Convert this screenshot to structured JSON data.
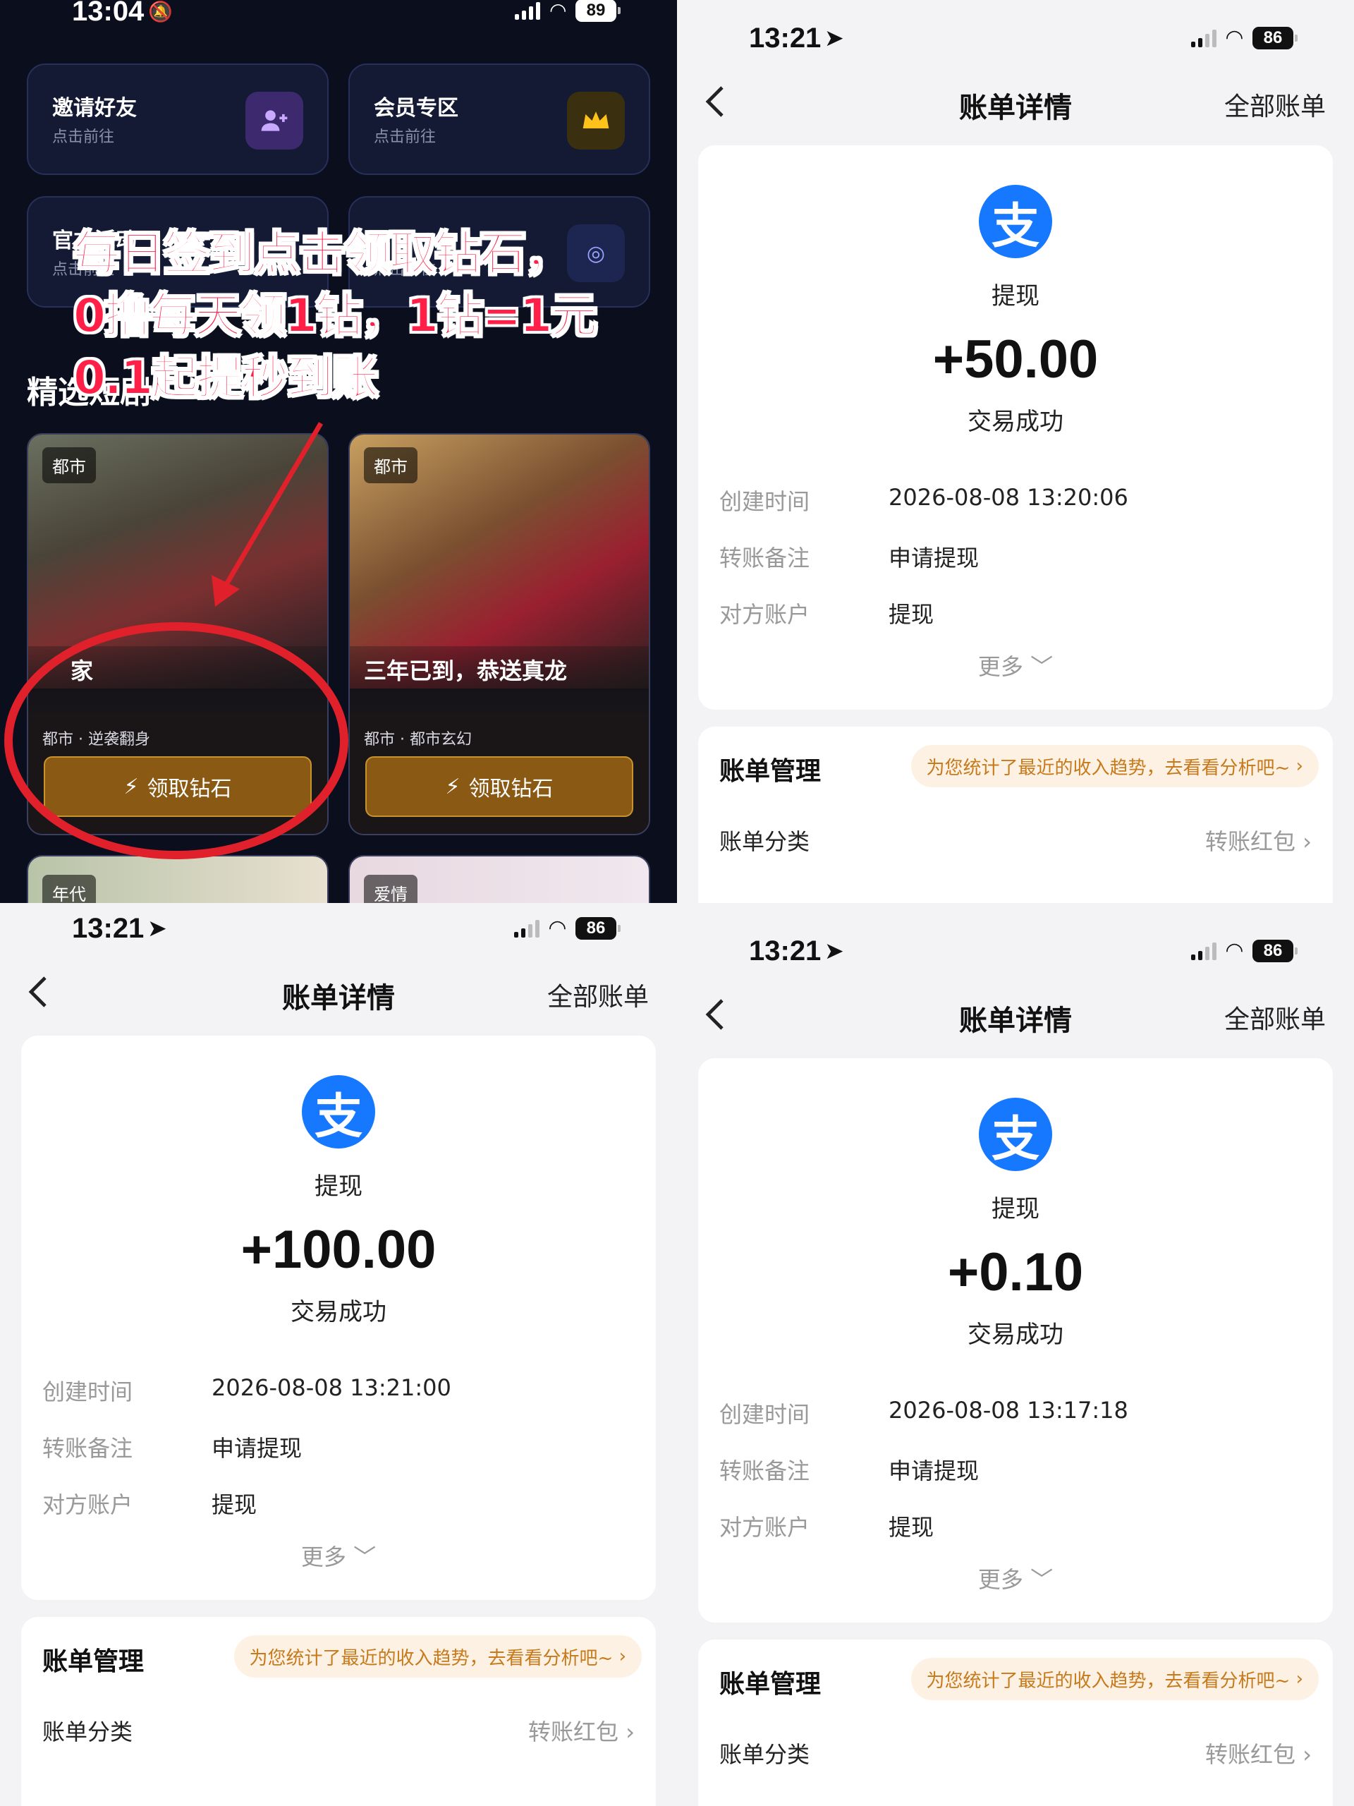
{
  "panel1": {
    "status": {
      "time": "13:04",
      "battery": "89"
    },
    "tiles": [
      {
        "title": "邀请好友",
        "subtitle": "点击前往",
        "icon": "add-user-icon"
      },
      {
        "title": "会员专区",
        "subtitle": "点击前往",
        "icon": "crown-icon"
      },
      {
        "title": "官方活动",
        "subtitle": "点击前往",
        "icon": "gift-icon"
      },
      {
        "title": "",
        "subtitle": "点击前往",
        "icon": "globe-icon"
      }
    ],
    "section_title": "精选短剧",
    "overlay_lines": [
      "每日签到点击领取钻石，",
      "0撸每天领1钻，1钻=1元",
      "0.1起提秒到账"
    ],
    "dramas": [
      {
        "tag": "都市",
        "title": "家",
        "meta": "都市 · 逆袭翻身",
        "button": "领取钻石"
      },
      {
        "tag": "都市",
        "title": "三年已到，恭送真龙",
        "meta": "都市 · 都市玄幻",
        "button": "领取钻石"
      },
      {
        "tag": "年代"
      },
      {
        "tag": "爱情"
      }
    ]
  },
  "bills": [
    {
      "time": "13:21",
      "battery": "86",
      "nav_title": "账单详情",
      "nav_all": "全部账单",
      "logo": "支",
      "type": "提现",
      "amount": "+50.00",
      "status": "交易成功",
      "rows": [
        {
          "k": "创建时间",
          "v": "2026-08-08 13:20:06"
        },
        {
          "k": "转账备注",
          "v": "申请提现"
        },
        {
          "k": "对方账户",
          "v": "提现"
        }
      ],
      "more": "更多",
      "mgmt": "账单管理",
      "tip": "为您统计了最近的收入趋势，去看看分析吧~",
      "cat_label": "账单分类",
      "cat_value": "转账红包"
    },
    {
      "time": "13:21",
      "battery": "86",
      "nav_title": "账单详情",
      "nav_all": "全部账单",
      "logo": "支",
      "type": "提现",
      "amount": "+100.00",
      "status": "交易成功",
      "rows": [
        {
          "k": "创建时间",
          "v": "2026-08-08 13:21:00"
        },
        {
          "k": "转账备注",
          "v": "申请提现"
        },
        {
          "k": "对方账户",
          "v": "提现"
        }
      ],
      "more": "更多",
      "mgmt": "账单管理",
      "tip": "为您统计了最近的收入趋势，去看看分析吧~",
      "cat_label": "账单分类",
      "cat_value": "转账红包"
    },
    {
      "time": "13:21",
      "battery": "86",
      "nav_title": "账单详情",
      "nav_all": "全部账单",
      "logo": "支",
      "type": "提现",
      "amount": "+0.10",
      "status": "交易成功",
      "rows": [
        {
          "k": "创建时间",
          "v": "2026-08-08 13:17:18"
        },
        {
          "k": "转账备注",
          "v": "申请提现"
        },
        {
          "k": "对方账户",
          "v": "提现"
        }
      ],
      "more": "更多",
      "mgmt": "账单管理",
      "tip": "为您统计了最近的收入趋势，去看看分析吧~",
      "cat_label": "账单分类",
      "cat_value": "转账红包"
    }
  ],
  "colors": {
    "alipay_blue": "#1677ff",
    "gold_button": "#8a5a14",
    "overlay_red": "#ff1f47",
    "circle_red": "#e0202a",
    "tip_text": "#c77a1c"
  }
}
